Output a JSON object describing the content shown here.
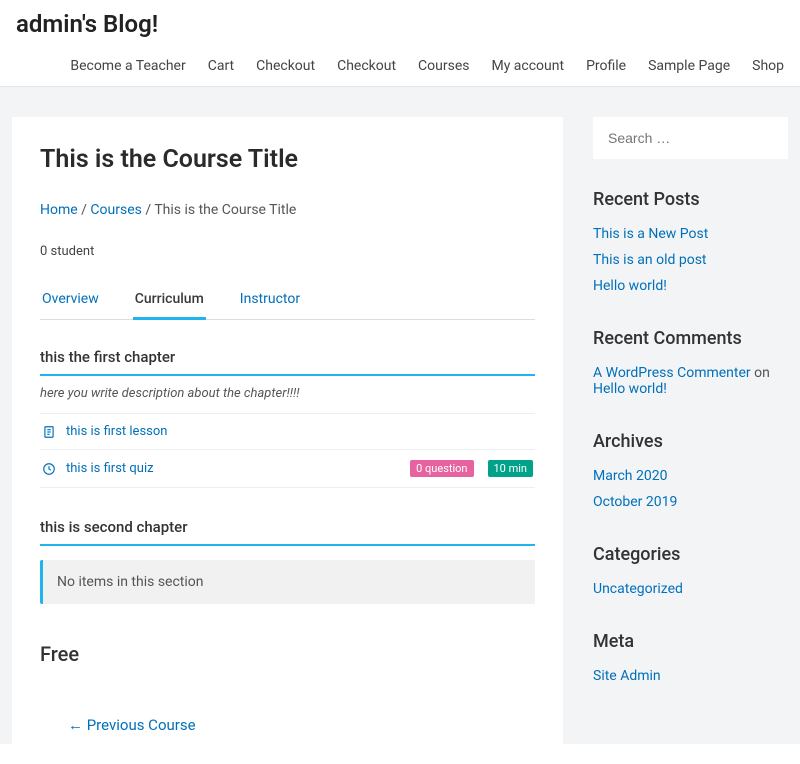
{
  "header": {
    "site_title": "admin's Blog!",
    "nav": [
      "Become a Teacher",
      "Cart",
      "Checkout",
      "Checkout",
      "Courses",
      "My account",
      "Profile",
      "Sample Page",
      "Shop"
    ]
  },
  "course": {
    "title": "This is the Course Title",
    "breadcrumb": {
      "home": "Home",
      "sep": " / ",
      "courses": "Courses",
      "current": "This is the Course Title"
    },
    "students": "0 student",
    "tabs": {
      "overview": "Overview",
      "curriculum": "Curriculum",
      "instructor": "Instructor"
    },
    "chapter1": {
      "title": "this the first chapter",
      "desc": "here you write description about the chapter!!!!",
      "lesson": "this is first lesson",
      "quiz": "this is first quiz",
      "questions": "0 question",
      "time": "10 min"
    },
    "chapter2": {
      "title": "this is second chapter",
      "noitems": "No items in this section"
    },
    "price": "Free",
    "prev": "← Previous Course"
  },
  "sidebar": {
    "search_placeholder": "Search …",
    "recent_posts": {
      "title": "Recent Posts",
      "items": [
        "This is a New Post",
        "This is an old post",
        "Hello world!"
      ]
    },
    "recent_comments": {
      "title": "Recent Comments",
      "commenter": "A WordPress Commenter",
      "on": " on ",
      "post": "Hello world!"
    },
    "archives": {
      "title": "Archives",
      "items": [
        "March 2020",
        "October 2019"
      ]
    },
    "categories": {
      "title": "Categories",
      "items": [
        "Uncategorized"
      ]
    },
    "meta": {
      "title": "Meta",
      "items": [
        "Site Admin"
      ]
    }
  }
}
